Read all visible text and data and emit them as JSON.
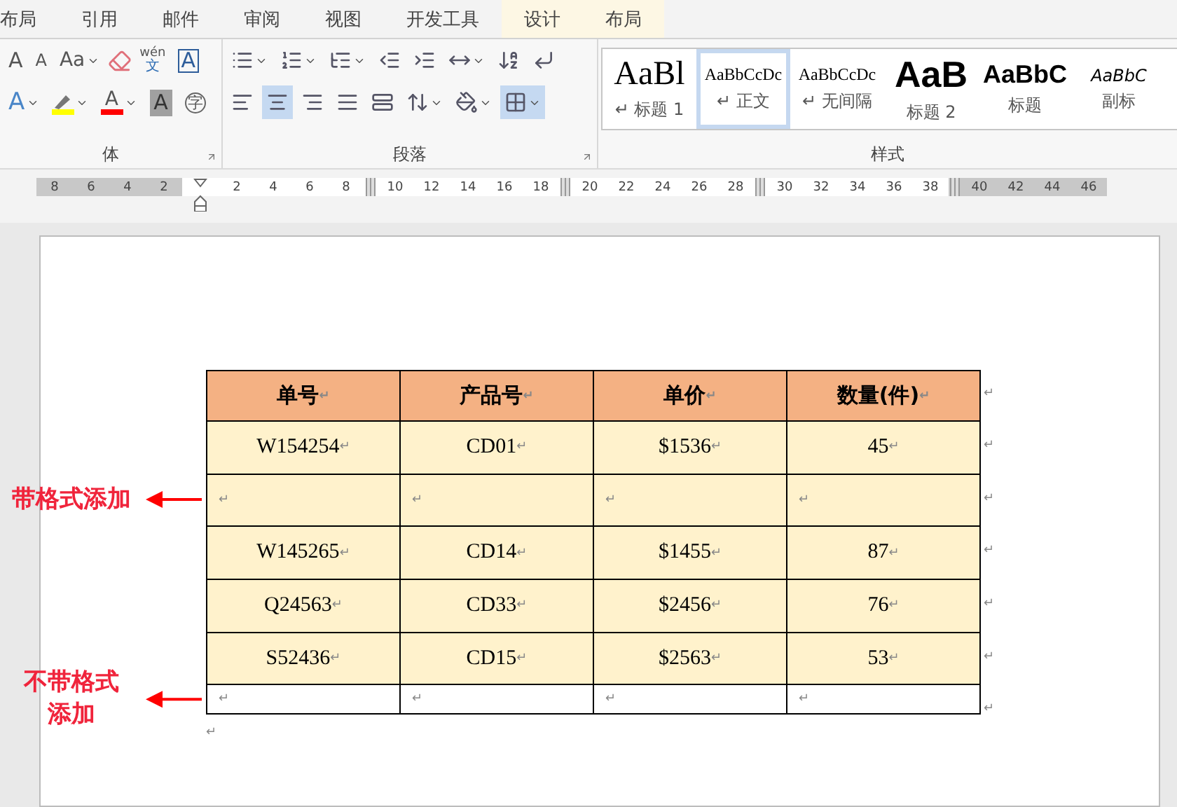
{
  "tabs": [
    {
      "label": "布局",
      "contextual": false
    },
    {
      "label": "引用",
      "contextual": false
    },
    {
      "label": "邮件",
      "contextual": false
    },
    {
      "label": "审阅",
      "contextual": false
    },
    {
      "label": "视图",
      "contextual": false
    },
    {
      "label": "开发工具",
      "contextual": false
    },
    {
      "label": "设计",
      "contextual": true
    },
    {
      "label": "布局",
      "contextual": true
    }
  ],
  "font_group": {
    "label": "体",
    "row1": [
      {
        "kind": "grow",
        "glyph": "A"
      },
      {
        "kind": "shrink",
        "glyph": "A"
      },
      {
        "kind": "case",
        "glyph": "Aa"
      },
      {
        "kind": "clear"
      },
      {
        "kind": "phonetic",
        "glyph": "wén",
        "glyph2": "文"
      },
      {
        "kind": "border",
        "glyph": "A"
      }
    ],
    "row2": [
      {
        "kind": "effect",
        "glyph": "A"
      },
      {
        "kind": "highlight",
        "color": "#ffff00"
      },
      {
        "kind": "fontcolor",
        "glyph": "A",
        "color": "#ff0000"
      },
      {
        "kind": "shade",
        "glyph": "A"
      },
      {
        "kind": "enclose",
        "glyph": "字"
      }
    ]
  },
  "paragraph_group": {
    "label": "段落",
    "row1": [
      {
        "kind": "bullets"
      },
      {
        "kind": "numbering"
      },
      {
        "kind": "multilevel"
      },
      {
        "kind": "outdent"
      },
      {
        "kind": "indent"
      },
      {
        "kind": "layout"
      },
      {
        "kind": "sort"
      },
      {
        "kind": "marks"
      }
    ],
    "row2": [
      {
        "kind": "left",
        "selected": false
      },
      {
        "kind": "center",
        "selected": true
      },
      {
        "kind": "right",
        "selected": false
      },
      {
        "kind": "justify",
        "selected": false
      },
      {
        "kind": "distribute",
        "selected": false
      },
      {
        "kind": "spacing",
        "selected": false
      },
      {
        "kind": "shading",
        "selected": false
      },
      {
        "kind": "borders",
        "selected": true
      }
    ]
  },
  "styles_group": {
    "label": "样式",
    "items": [
      {
        "preview": "AaBl",
        "name": "标题 1",
        "mark": "↵",
        "kind": "serif_big",
        "selected": false
      },
      {
        "preview": "AaBbCcDc",
        "name": "正文",
        "mark": "↵",
        "kind": "serif_small",
        "selected": true
      },
      {
        "preview": "AaBbCcDc",
        "name": "无间隔",
        "mark": "↵",
        "kind": "serif_small",
        "selected": false
      },
      {
        "preview": "AaB",
        "name": "标题 2",
        "kind": "sans_big",
        "selected": false
      },
      {
        "preview": "AaBbC",
        "name": "标题",
        "kind": "sans_mid",
        "selected": false
      },
      {
        "preview": "AaBbC",
        "name": "副标",
        "kind": "italic",
        "selected": false
      }
    ]
  },
  "ruler": [
    {
      "label": "8",
      "margin": true
    },
    {
      "label": "6",
      "margin": true
    },
    {
      "label": "4",
      "margin": true
    },
    {
      "label": "2",
      "margin": true
    },
    {
      "kind": "indent",
      "margin": false
    },
    {
      "label": "2",
      "margin": false
    },
    {
      "label": "4",
      "margin": false
    },
    {
      "label": "6",
      "margin": false
    },
    {
      "label": "8",
      "margin": false
    },
    {
      "kind": "marker",
      "margin": false
    },
    {
      "label": "10",
      "margin": false
    },
    {
      "label": "12",
      "margin": false
    },
    {
      "label": "14",
      "margin": false
    },
    {
      "label": "16",
      "margin": false
    },
    {
      "label": "18",
      "margin": false
    },
    {
      "kind": "marker",
      "margin": false
    },
    {
      "label": "20",
      "margin": false
    },
    {
      "label": "22",
      "margin": false
    },
    {
      "label": "24",
      "margin": false
    },
    {
      "label": "26",
      "margin": false
    },
    {
      "label": "28",
      "margin": false
    },
    {
      "kind": "marker",
      "margin": false
    },
    {
      "label": "30",
      "margin": false
    },
    {
      "label": "32",
      "margin": false
    },
    {
      "label": "34",
      "margin": false
    },
    {
      "label": "36",
      "margin": false
    },
    {
      "label": "38",
      "margin": false
    },
    {
      "kind": "marker",
      "margin": true
    },
    {
      "label": "40",
      "margin": true
    },
    {
      "label": "42",
      "margin": true
    },
    {
      "label": "44",
      "margin": true
    },
    {
      "label": "46",
      "margin": true
    }
  ],
  "table": {
    "header": [
      {
        "text": "单号",
        "mark": "↵"
      },
      {
        "text": "产品号",
        "mark": "↵"
      },
      {
        "text": "单价",
        "mark": "↵"
      },
      {
        "text": "数量(件)",
        "mark": "↵"
      }
    ],
    "header_end": "↵",
    "rows": [
      {
        "shaded": true,
        "end": "↵",
        "cells": [
          {
            "text": "W154254",
            "mark": "↵"
          },
          {
            "text": "CD01",
            "mark": "↵"
          },
          {
            "text": "$1536",
            "mark": "↵"
          },
          {
            "text": "45",
            "mark": "↵"
          }
        ]
      },
      {
        "shaded": true,
        "end": "↵",
        "annotation": [
          "带格式添加"
        ],
        "cells": [
          {
            "mark": "↵"
          },
          {
            "mark": "↵"
          },
          {
            "mark": "↵"
          },
          {
            "mark": "↵"
          }
        ]
      },
      {
        "shaded": true,
        "end": "↵",
        "cells": [
          {
            "text": "W145265",
            "mark": "↵"
          },
          {
            "text": "CD14",
            "mark": "↵"
          },
          {
            "text": "$1455",
            "mark": "↵"
          },
          {
            "text": "87",
            "mark": "↵"
          }
        ]
      },
      {
        "shaded": true,
        "end": "↵",
        "cells": [
          {
            "text": "Q24563",
            "mark": "↵"
          },
          {
            "text": "CD33",
            "mark": "↵"
          },
          {
            "text": "$2456",
            "mark": "↵"
          },
          {
            "text": "76",
            "mark": "↵"
          }
        ]
      },
      {
        "shaded": true,
        "end": "↵",
        "cells": [
          {
            "text": "S52436",
            "mark": "↵"
          },
          {
            "text": "CD15",
            "mark": "↵"
          },
          {
            "text": "$2563",
            "mark": "↵"
          },
          {
            "text": "53",
            "mark": "↵"
          }
        ]
      },
      {
        "shaded": false,
        "end": "↵",
        "annotation": [
          "不带格式",
          "添加"
        ],
        "cells": [
          {
            "mark": "↵"
          },
          {
            "mark": "↵"
          },
          {
            "mark": "↵"
          },
          {
            "mark": "↵"
          }
        ]
      }
    ]
  },
  "after_table_mark": "↵"
}
